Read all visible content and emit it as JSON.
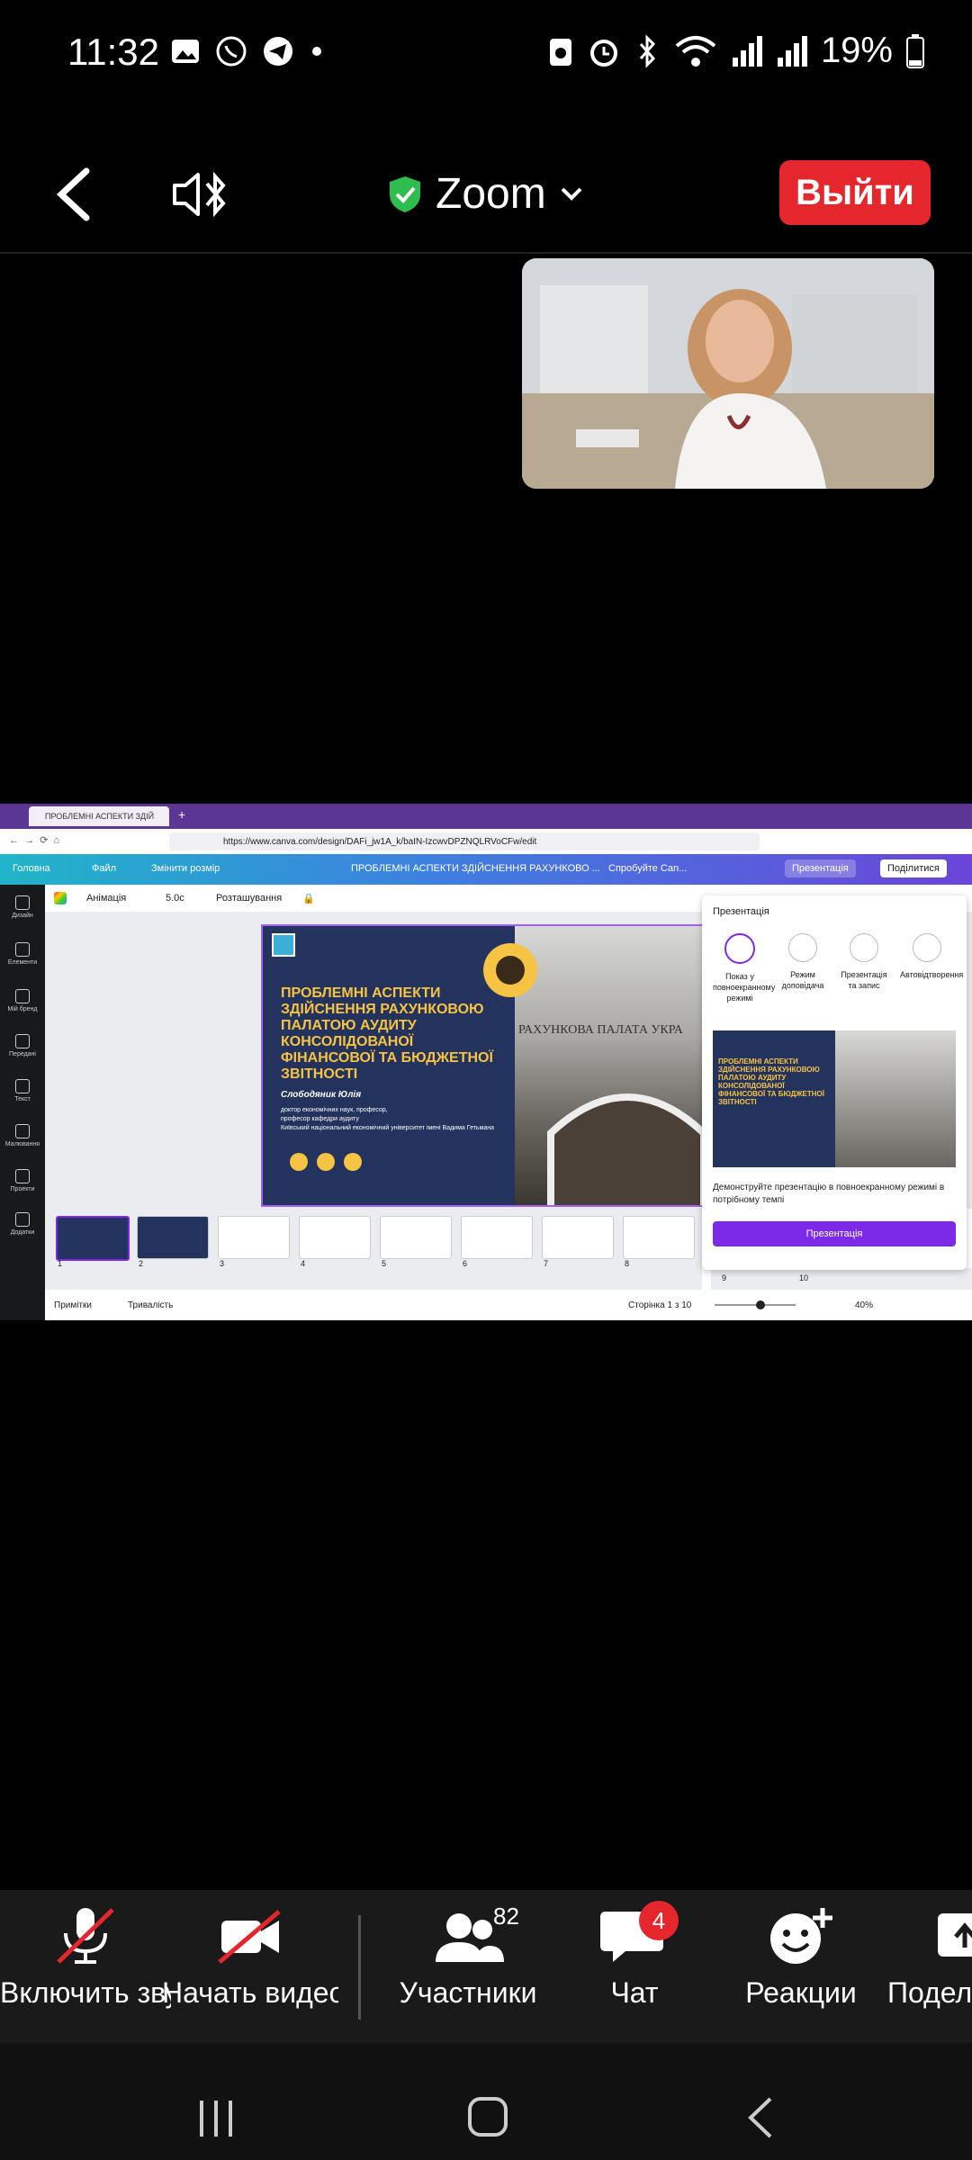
{
  "status_bar": {
    "time": "11:32",
    "battery": "19%"
  },
  "header": {
    "title": "Zoom",
    "leave_label": "Выйти",
    "shield_color": "#2dbe4e",
    "leave_color": "#e5262c"
  },
  "shared_screen": {
    "browser_tab_label": "ПРОБЛЕМНІ АСПЕКТИ ЗДІЙ",
    "url": "https://www.canva.com/design/DAFi_jw1A_k/baIN-IzcwvDPZNQLRVoCFw/edit",
    "canva_menu": {
      "home": "Головна",
      "file": "Файл",
      "resize": "Змінити розмір",
      "doc_title": "ПРОБЛЕМНІ АСПЕКТИ ЗДІЙСНЕННЯ РАХУНКОВО ...",
      "try_canva": "Спробуйте Can...",
      "present": "Презентація",
      "share": "Поділитися"
    },
    "sidebar_items": [
      "Дизайн",
      "Елементи",
      "Мій бренд",
      "Передані",
      "Текст",
      "Малювання",
      "Проекти",
      "Додатки"
    ],
    "edit_toolbar": {
      "animation": "Анімація",
      "duration": "5.0с",
      "position": "Розташування"
    },
    "slide": {
      "title": "ПРОБЛЕМНІ АСПЕКТИ ЗДІЙСНЕННЯ РАХУНКОВОЮ ПАЛАТОЮ АУДИТУ КОНСОЛІДОВАНОЇ ФІНАНСОВОЇ ТА БЮДЖЕТНОЇ ЗВІТНОСТІ",
      "author": "Слободяник Юлія",
      "subtitle_lines": [
        "доктор економічних наук, професор,",
        "професор кафедри аудиту",
        "Київський національний економічний університет імені Вадима Гетьмана"
      ],
      "building_sign": "РАХУНКОВА ПАЛАТА УКРА"
    },
    "thumbnails": [
      "1",
      "2",
      "3",
      "4",
      "5",
      "6",
      "7",
      "8",
      "9",
      "10"
    ],
    "bottom": {
      "notes": "Примітки",
      "duration": "Тривалість",
      "page": "Сторінка 1 з 10",
      "zoom": "40%"
    },
    "present_panel": {
      "title": "Презентація",
      "options": [
        "Показ у повноекранному режимі",
        "Режим доповідача",
        "Презентація та запис",
        "Автовідтворення"
      ],
      "description": "Демонструйте презентацію в повноекранному режимі в потрібному темпі",
      "button": "Презентація"
    }
  },
  "toolbar": {
    "mic": "Включить звук",
    "video": "Начать видео",
    "participants": "Участники",
    "participants_count": "82",
    "chat": "Чат",
    "chat_badge": "4",
    "reactions": "Реакции",
    "share": "Поделиться"
  }
}
